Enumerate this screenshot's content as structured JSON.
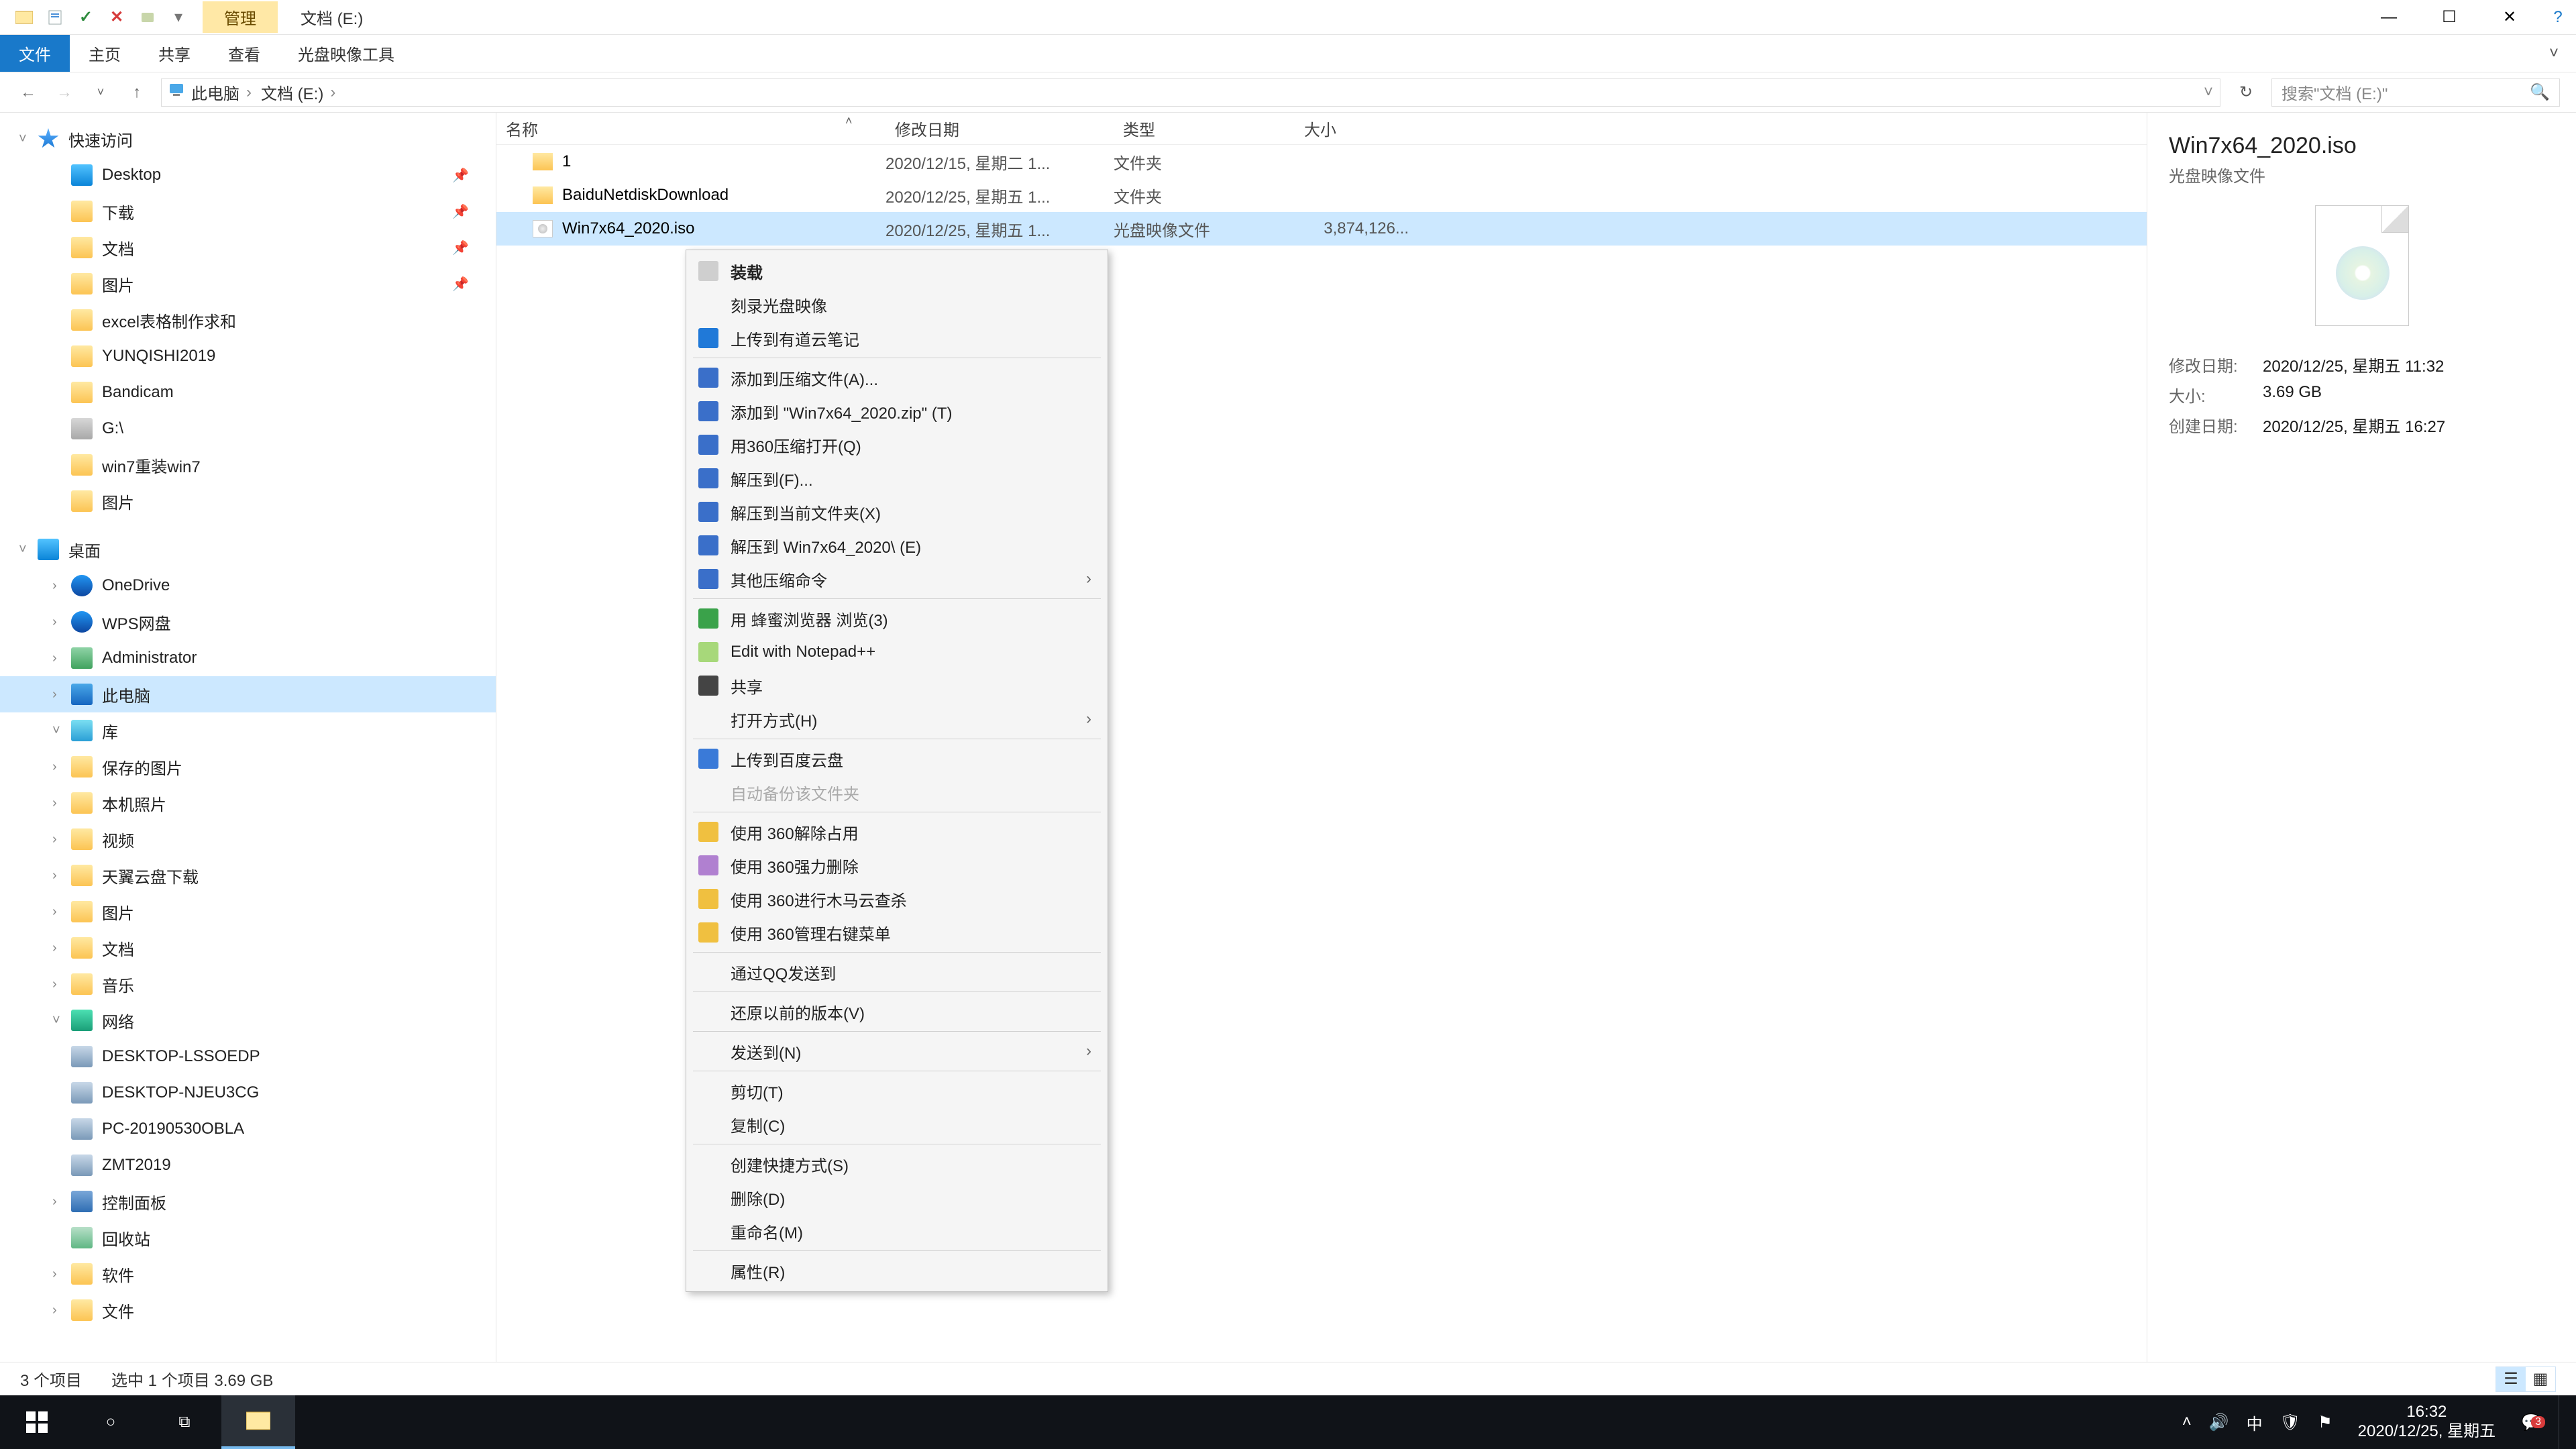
{
  "window": {
    "context_tab": "管理",
    "title": "文档 (E:)",
    "ribbon": {
      "file": "文件",
      "home": "主页",
      "share": "共享",
      "view": "查看",
      "disc_tools": "光盘映像工具"
    }
  },
  "address": {
    "segs": [
      "此电脑",
      "文档 (E:)"
    ],
    "search_placeholder": "搜索\"文档 (E:)\""
  },
  "nav": {
    "quick_access": "快速访问",
    "items_qa": [
      "Desktop",
      "下载",
      "文档",
      "图片",
      "excel表格制作求和",
      "YUNQISHI2019",
      "Bandicam",
      "G:\\",
      "win7重装win7",
      "图片"
    ],
    "desktop_group": "桌面",
    "items_desktop": [
      "OneDrive",
      "WPS网盘",
      "Administrator",
      "此电脑",
      "库"
    ],
    "lib_items": [
      "保存的图片",
      "本机照片",
      "视频",
      "天翼云盘下载",
      "图片",
      "文档",
      "音乐"
    ],
    "network": "网络",
    "net_items": [
      "DESKTOP-LSSOEDP",
      "DESKTOP-NJEU3CG",
      "PC-20190530OBLA",
      "ZMT2019"
    ],
    "others": [
      "控制面板",
      "回收站",
      "软件",
      "文件"
    ]
  },
  "columns": {
    "name": "名称",
    "date": "修改日期",
    "type": "类型",
    "size": "大小"
  },
  "files": [
    {
      "name": "1",
      "date": "2020/12/15, 星期二 1...",
      "type": "文件夹",
      "size": "",
      "kind": "folder"
    },
    {
      "name": "BaiduNetdiskDownload",
      "date": "2020/12/25, 星期五 1...",
      "type": "文件夹",
      "size": "",
      "kind": "folder"
    },
    {
      "name": "Win7x64_2020.iso",
      "date": "2020/12/25, 星期五 1...",
      "type": "光盘映像文件",
      "size": "3,874,126...",
      "kind": "iso",
      "selected": true
    }
  ],
  "context_menu": [
    {
      "label": "装载",
      "ico": "disc",
      "bold": true
    },
    {
      "label": "刻录光盘映像",
      "ico": "blank"
    },
    {
      "label": "上传到有道云笔记",
      "ico": "blue"
    },
    {
      "sep": true
    },
    {
      "label": "添加到压缩文件(A)...",
      "ico": "zip"
    },
    {
      "label": "添加到 \"Win7x64_2020.zip\" (T)",
      "ico": "zip"
    },
    {
      "label": "用360压缩打开(Q)",
      "ico": "zip"
    },
    {
      "label": "解压到(F)...",
      "ico": "zip"
    },
    {
      "label": "解压到当前文件夹(X)",
      "ico": "zip"
    },
    {
      "label": "解压到 Win7x64_2020\\ (E)",
      "ico": "zip"
    },
    {
      "label": "其他压缩命令",
      "ico": "zip",
      "arrow": true
    },
    {
      "sep": true
    },
    {
      "label": "用 蜂蜜浏览器 浏览(3)",
      "ico": "green"
    },
    {
      "label": "Edit with Notepad++",
      "ico": "npp"
    },
    {
      "label": "共享",
      "ico": "share"
    },
    {
      "label": "打开方式(H)",
      "ico": "blank",
      "arrow": true
    },
    {
      "sep": true
    },
    {
      "label": "上传到百度云盘",
      "ico": "baidu"
    },
    {
      "label": "自动备份该文件夹",
      "ico": "blank",
      "disabled": true
    },
    {
      "sep": true
    },
    {
      "label": "使用 360解除占用",
      "ico": "y360"
    },
    {
      "label": "使用 360强力删除",
      "ico": "y360b"
    },
    {
      "label": "使用 360进行木马云查杀",
      "ico": "y360c"
    },
    {
      "label": "使用 360管理右键菜单",
      "ico": "y360c"
    },
    {
      "sep": true
    },
    {
      "label": "通过QQ发送到",
      "ico": "blank"
    },
    {
      "sep": true
    },
    {
      "label": "还原以前的版本(V)",
      "ico": "blank"
    },
    {
      "sep": true
    },
    {
      "label": "发送到(N)",
      "ico": "blank",
      "arrow": true
    },
    {
      "sep": true
    },
    {
      "label": "剪切(T)",
      "ico": "blank"
    },
    {
      "label": "复制(C)",
      "ico": "blank"
    },
    {
      "sep": true
    },
    {
      "label": "创建快捷方式(S)",
      "ico": "blank"
    },
    {
      "label": "删除(D)",
      "ico": "blank"
    },
    {
      "label": "重命名(M)",
      "ico": "blank"
    },
    {
      "sep": true
    },
    {
      "label": "属性(R)",
      "ico": "blank"
    }
  ],
  "details": {
    "title": "Win7x64_2020.iso",
    "subtitle": "光盘映像文件",
    "rows": [
      {
        "lbl": "修改日期:",
        "val": "2020/12/25, 星期五 11:32"
      },
      {
        "lbl": "大小:",
        "val": "3.69 GB"
      },
      {
        "lbl": "创建日期:",
        "val": "2020/12/25, 星期五 16:27"
      }
    ]
  },
  "status": {
    "count": "3 个项目",
    "selection": "选中 1 个项目  3.69 GB"
  },
  "taskbar": {
    "time": "16:32",
    "date": "2020/12/25, 星期五",
    "ime": "中",
    "notif_badge": "3"
  }
}
